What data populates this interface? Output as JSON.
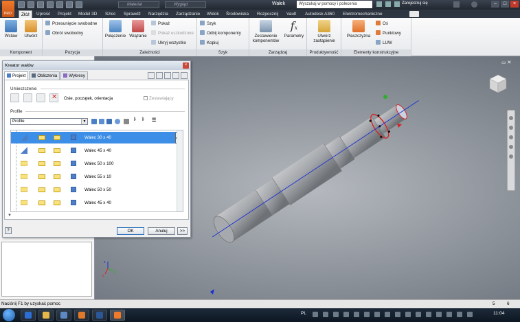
{
  "titlebar": {
    "material_combo": "Materiał",
    "appearance_combo": "Wygląd",
    "title": "Wałek",
    "search_placeholder": "Wyszukaj w pomocy i polecenia",
    "user_label": "Zarejestruj się",
    "app_logo_text": "PRO"
  },
  "tabs": [
    {
      "label": "Złóż"
    },
    {
      "label": "Uprość"
    },
    {
      "label": "Projekt"
    },
    {
      "label": "Model 3D"
    },
    {
      "label": "Szkic"
    },
    {
      "label": "Sprawdź"
    },
    {
      "label": "Narzędzia"
    },
    {
      "label": "Zarządzanie"
    },
    {
      "label": "Widok"
    },
    {
      "label": "Środowiska"
    },
    {
      "label": "Rozpocznij"
    },
    {
      "label": "Vault"
    },
    {
      "label": "Autodesk A360"
    },
    {
      "label": "Elektromechaniczne"
    }
  ],
  "ribbon": {
    "wstaw": "Wstaw",
    "utworz": "Utwórz",
    "przesuniecie": "Przesunięcie swobodne",
    "obrot": "Obrót swobodny",
    "polaczenie": "Połączenie",
    "wiazanie": "Wiązanie",
    "pokaz": "Pokaż",
    "pokaz_uszk": "Pokaż uszkodzone",
    "ukryj": "Ukryj wszystko",
    "szyk": "Szyk",
    "odbij": "Odbij komponenty",
    "kopiuj": "Kopiuj",
    "zestawienie_1": "Zestawienie",
    "zestawienie_2": "komponentów",
    "parametry": "Parametry",
    "utworz_zast_1": "Utwórz",
    "utworz_zast_2": "zastąpienie",
    "plaszczyzna": "Płaszczyzna",
    "os": "Oś",
    "punktowy": "Punktowy",
    "luw": "LUW",
    "groups": {
      "komponent": "Komponent",
      "pozycja": "Pozycja",
      "zaleznosci": "Zależności",
      "szyk": "Szyk",
      "zarzadzaj": "Zarządzaj",
      "produktywnosc": "Produktywność",
      "elementy": "Elementy konstrukcyjne"
    }
  },
  "dialog": {
    "title": "Kreator wałów",
    "tabs": {
      "projekt": "Projekt",
      "obliczenia": "Obliczenia",
      "wykresy": "Wykresy"
    },
    "umieszczenie": "Umieszczenie",
    "placement_text": "Osie, początek, orientacja",
    "zestawiajacy": "Zestawiający",
    "profile_label": "Profile",
    "profile_value": "Profile",
    "sections": [
      {
        "label": "Walec 30 x 40",
        "selected": true
      },
      {
        "label": "Walec 45 x 40",
        "selected": false
      },
      {
        "label": "Walec 50 x 100",
        "selected": false
      },
      {
        "label": "Walec 55 x 10",
        "selected": false
      },
      {
        "label": "Walec 50 x 50",
        "selected": false
      },
      {
        "label": "Walec 45 x 40",
        "selected": false
      }
    ],
    "help": "?",
    "ok": "OK",
    "cancel": "Anuluj",
    "more": ">>"
  },
  "statusbar": {
    "text": "Naciśnij F1 by uzyskać pomoc",
    "num1": "5",
    "num2": "6"
  },
  "taskbar": {
    "lang": "PL",
    "time": "11:04"
  },
  "colors": {
    "selection": "#3d8ee6",
    "axis_blue": "#1b2fd6",
    "shaft_gray": "#a3a6aa"
  }
}
